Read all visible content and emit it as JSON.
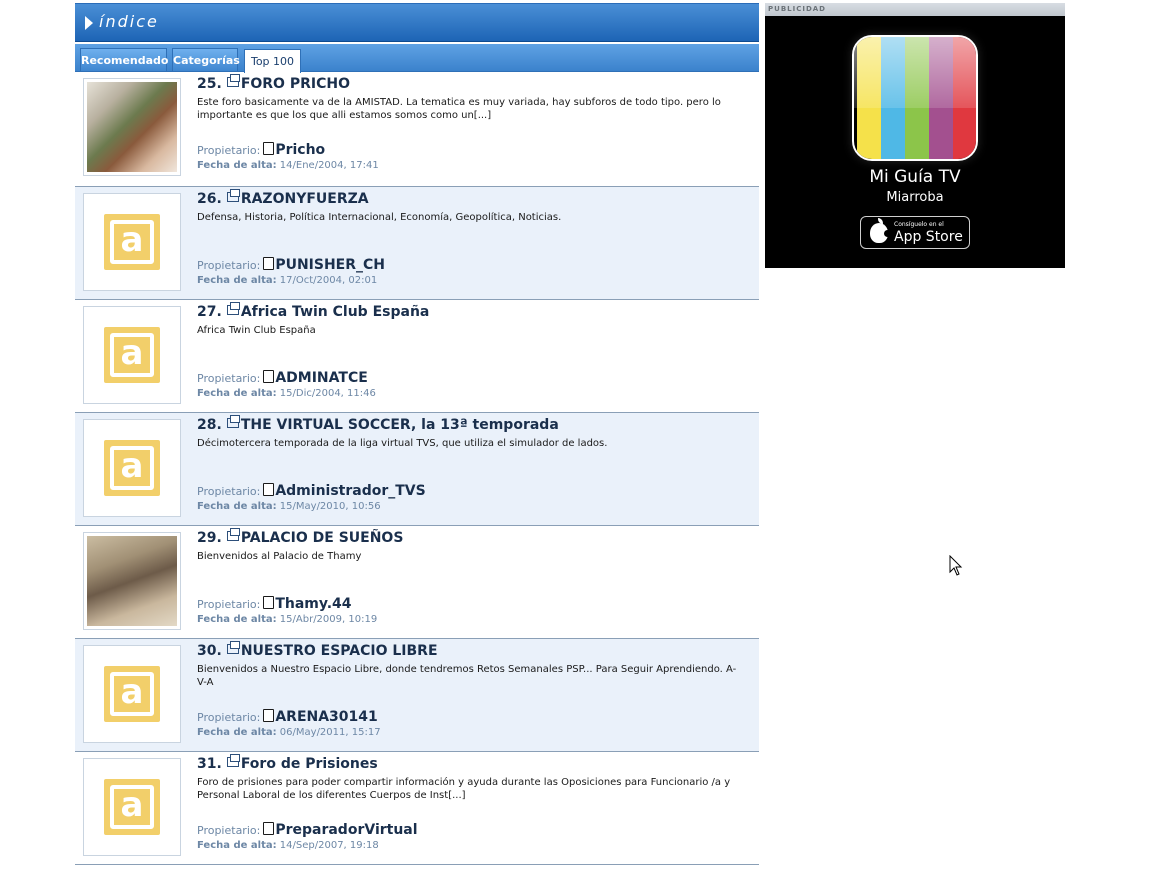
{
  "header": {
    "title": "índice"
  },
  "tabs": [
    {
      "label": "Recomendado"
    },
    {
      "label": "Categorías"
    },
    {
      "label": "Top 100"
    }
  ],
  "forums": [
    {
      "num": "25.",
      "title": "FORO PRICHO",
      "description": "Este foro basicamente va de la AMISTAD. La tematica es muy variada, hay subforos de todo tipo. pero lo importante es que los que alli estamos somos como un[...]",
      "owner_label": "Propietario:",
      "owner": "Pricho",
      "date_label": "Fecha de alta:",
      "date": "14/Ene/2004, 17:41",
      "thumb": "photo"
    },
    {
      "num": "26.",
      "title": "RAZONYFUERZA",
      "description": "Defensa, Historia, Política Internacional, Economía, Geopolítica, Noticias.",
      "owner_label": "Propietario:",
      "owner": "PUNISHER_CH",
      "date_label": "Fecha de alta:",
      "date": "17/Oct/2004, 02:01",
      "thumb": "logo"
    },
    {
      "num": "27.",
      "title": "Africa Twin Club España",
      "description": "Africa Twin Club España",
      "owner_label": "Propietario:",
      "owner": "ADMINATCE",
      "date_label": "Fecha de alta:",
      "date": "15/Dic/2004, 11:46",
      "thumb": "logo"
    },
    {
      "num": "28.",
      "title": "THE VIRTUAL SOCCER, la 13ª temporada",
      "description": "Décimotercera temporada de la liga virtual TVS, que utiliza el simulador de lados.",
      "owner_label": "Propietario:",
      "owner": "Administrador_TVS",
      "date_label": "Fecha de alta:",
      "date": "15/May/2010, 10:56",
      "thumb": "logo"
    },
    {
      "num": "29.",
      "title": "PALACIO DE SUEÑOS",
      "description": "Bienvenidos al Palacio de Thamy",
      "owner_label": "Propietario:",
      "owner": "Thamy.44",
      "date_label": "Fecha de alta:",
      "date": "15/Abr/2009, 10:19",
      "thumb": "photo"
    },
    {
      "num": "30.",
      "title": "NUESTRO ESPACIO LIBRE",
      "description": "Bienvenidos a Nuestro Espacio Libre, donde tendremos Retos Semanales PSP... Para Seguir Aprendiendo. A-V-A",
      "owner_label": "Propietario:",
      "owner": "ARENA30141",
      "date_label": "Fecha de alta:",
      "date": "06/May/2011, 15:17",
      "thumb": "logo"
    },
    {
      "num": "31.",
      "title": "Foro de Prisiones",
      "description": "Foro de prisiones para poder compartir información y ayuda durante las Oposiciones para Funcionario /a y Personal Laboral de los diferentes Cuerpos de Inst[...]",
      "owner_label": "Propietario:",
      "owner": "PreparadorVirtual",
      "date_label": "Fecha de alta:",
      "date": "14/Sep/2007, 19:18",
      "thumb": "logo"
    }
  ],
  "ad": {
    "label": "PUBLICIDAD",
    "app_title": "Mi Guía TV",
    "app_subtitle": "Miarroba",
    "store_small": "Consíguelo en el",
    "store_big": "App Store",
    "stripe_colors": [
      "#f5e14a",
      "#4fb8e6",
      "#8cc54a",
      "#a3508f",
      "#e0383f"
    ]
  }
}
